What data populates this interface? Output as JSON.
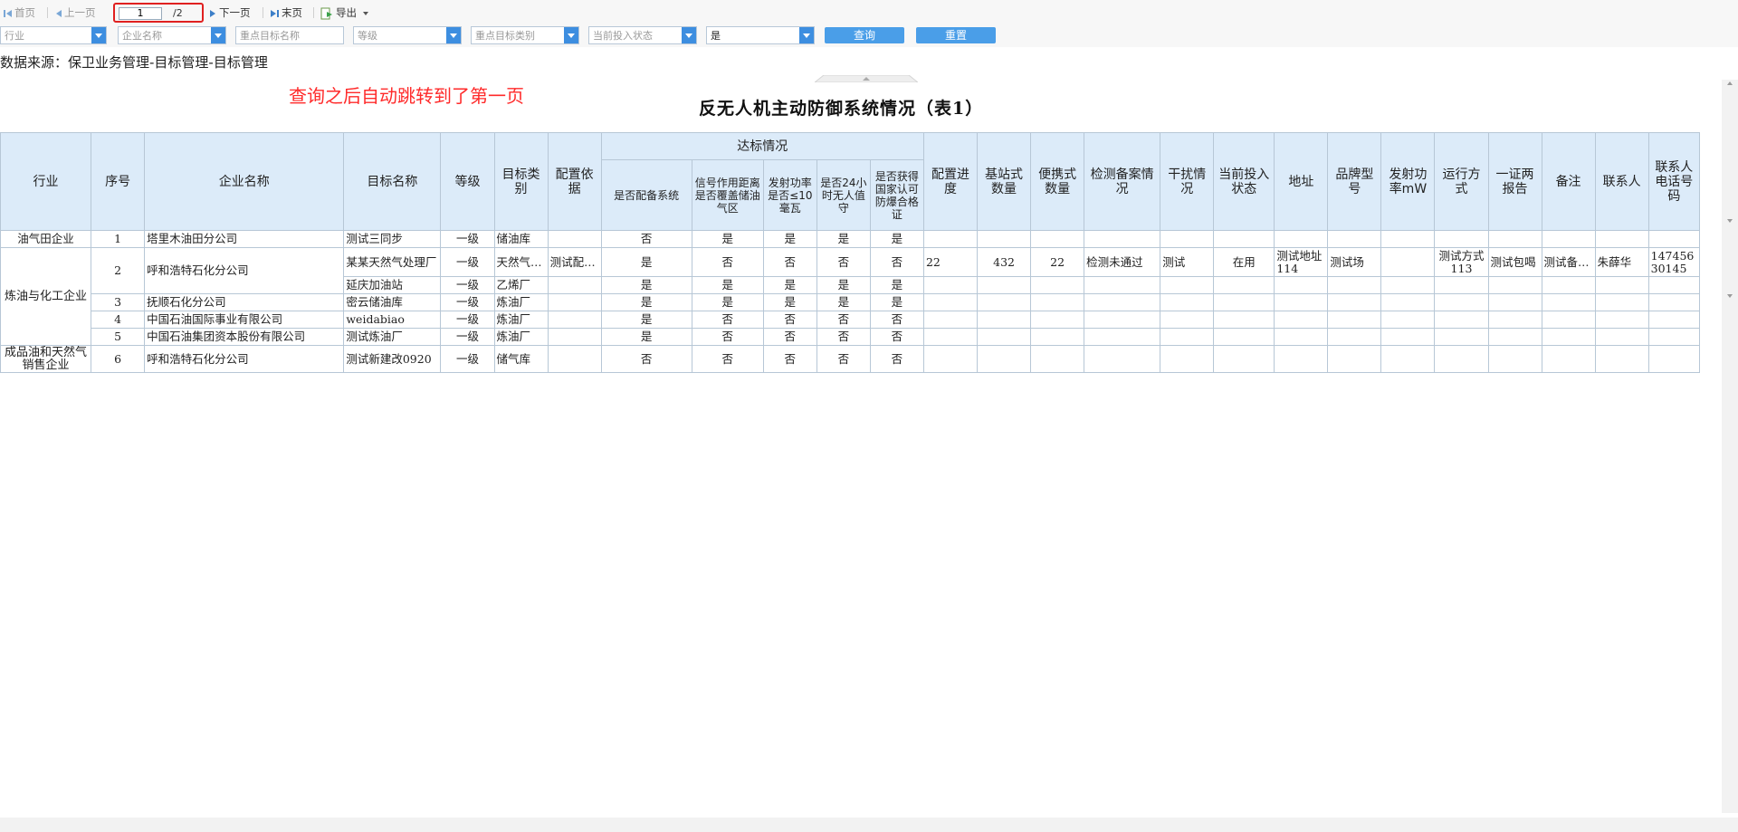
{
  "toolbar": {
    "first": "首页",
    "prev": "上一页",
    "page_current": "1",
    "page_total": "/2",
    "next": "下一页",
    "last": "末页",
    "export": "导出"
  },
  "filters": {
    "industry": "行业",
    "company": "企业名称",
    "target_name": "重点目标名称",
    "level": "等级",
    "target_type": "重点目标类别",
    "status": "当前投入状态",
    "selected": "是",
    "query_button": "查询",
    "reset_button": "重置"
  },
  "source_text": "数据来源：保卫业务管理-目标管理-目标管理",
  "annotation": "查询之后自动跳转到了第一页",
  "report_title": "反无人机主动防御系统情况（表1）",
  "headers": {
    "industry": "行业",
    "seq": "序号",
    "company": "企业名称",
    "target": "目标名称",
    "level": "等级",
    "type": "目标类别",
    "basis": "配置依据",
    "standard_group": "达标情况",
    "has_system": "是否配备系统",
    "signal": "信号作用距离是否覆盖储油气区",
    "power": "发射功率是否≤10毫瓦",
    "duty": "是否24小时无人值守",
    "cert": "是否获得国家认可防爆合格证",
    "progress": "配置进度",
    "base_qty": "基站式数量",
    "portable_qty": "便携式数量",
    "record": "检测备案情况",
    "interference": "干扰情况",
    "status": "当前投入状态",
    "address": "地址",
    "brand": "品牌型号",
    "tx_power": "发射功率mW",
    "mode": "运行方式",
    "reports": "一证两报告",
    "remark": "备注",
    "contact": "联系人",
    "phone": "联系人电话号码"
  },
  "industries": [
    "油气田企业",
    "炼油与化工企业",
    "成品油和天然气销售企业"
  ],
  "rows": [
    {
      "seq": "1",
      "company": "塔里木油田分公司",
      "target": "测试三同步",
      "level": "一级",
      "type": "储油库",
      "basis": "",
      "c1": "否",
      "c2": "是",
      "c3": "是",
      "c4": "是",
      "c5": "是",
      "progress": "",
      "base": "",
      "portable": "",
      "record": "",
      "interf": "",
      "status": "",
      "address": "",
      "brand": "",
      "txp": "",
      "mode": "",
      "reports": "",
      "remark": "",
      "contact": "",
      "phone": ""
    },
    {
      "seq": "2",
      "company": "呼和浩特石化分公司",
      "target": "某某天然气处理厂",
      "level": "一级",
      "type": "天然气…",
      "basis": "测试配…",
      "c1": "是",
      "c2": "否",
      "c3": "否",
      "c4": "否",
      "c5": "否",
      "progress": "22",
      "base": "432",
      "portable": "22",
      "record": "检测未通过",
      "interf": "测试",
      "status": "在用",
      "address": "测试地址114",
      "brand": "测试场",
      "txp": "",
      "mode": "测试方式113",
      "reports": "测试包喝",
      "remark": "测试备…",
      "contact": "朱薛华",
      "phone": "14745630145"
    },
    {
      "seq": "",
      "company": "",
      "target": "延庆加油站",
      "level": "一级",
      "type": "乙烯厂",
      "basis": "",
      "c1": "是",
      "c2": "是",
      "c3": "是",
      "c4": "是",
      "c5": "是",
      "progress": "",
      "base": "",
      "portable": "",
      "record": "",
      "interf": "",
      "status": "",
      "address": "",
      "brand": "",
      "txp": "",
      "mode": "",
      "reports": "",
      "remark": "",
      "contact": "",
      "phone": ""
    },
    {
      "seq": "3",
      "company": "抚顺石化分公司",
      "target": "密云储油库",
      "level": "一级",
      "type": "炼油厂",
      "basis": "",
      "c1": "是",
      "c2": "是",
      "c3": "是",
      "c4": "是",
      "c5": "是",
      "progress": "",
      "base": "",
      "portable": "",
      "record": "",
      "interf": "",
      "status": "",
      "address": "",
      "brand": "",
      "txp": "",
      "mode": "",
      "reports": "",
      "remark": "",
      "contact": "",
      "phone": ""
    },
    {
      "seq": "4",
      "company": "中国石油国际事业有限公司",
      "target": "weidabiao",
      "level": "一级",
      "type": "炼油厂",
      "basis": "",
      "c1": "是",
      "c2": "否",
      "c3": "否",
      "c4": "否",
      "c5": "否",
      "progress": "",
      "base": "",
      "portable": "",
      "record": "",
      "interf": "",
      "status": "",
      "address": "",
      "brand": "",
      "txp": "",
      "mode": "",
      "reports": "",
      "remark": "",
      "contact": "",
      "phone": ""
    },
    {
      "seq": "5",
      "company": "中国石油集团资本股份有限公司",
      "target": "测试炼油厂",
      "level": "一级",
      "type": "炼油厂",
      "basis": "",
      "c1": "是",
      "c2": "否",
      "c3": "否",
      "c4": "否",
      "c5": "否",
      "progress": "",
      "base": "",
      "portable": "",
      "record": "",
      "interf": "",
      "status": "",
      "address": "",
      "brand": "",
      "txp": "",
      "mode": "",
      "reports": "",
      "remark": "",
      "contact": "",
      "phone": ""
    },
    {
      "seq": "6",
      "company": "呼和浩特石化分公司",
      "target": "测试新建改0920",
      "level": "一级",
      "type": "储气库",
      "basis": "",
      "c1": "否",
      "c2": "否",
      "c3": "否",
      "c4": "否",
      "c5": "否",
      "progress": "",
      "base": "",
      "portable": "",
      "record": "",
      "interf": "",
      "status": "",
      "address": "",
      "brand": "",
      "txp": "",
      "mode": "",
      "reports": "",
      "remark": "",
      "contact": "",
      "phone": ""
    }
  ],
  "colors": {
    "accent": "#3d8ee0",
    "header_bg": "#dcebf9",
    "annotation": "#ff2a2a"
  }
}
